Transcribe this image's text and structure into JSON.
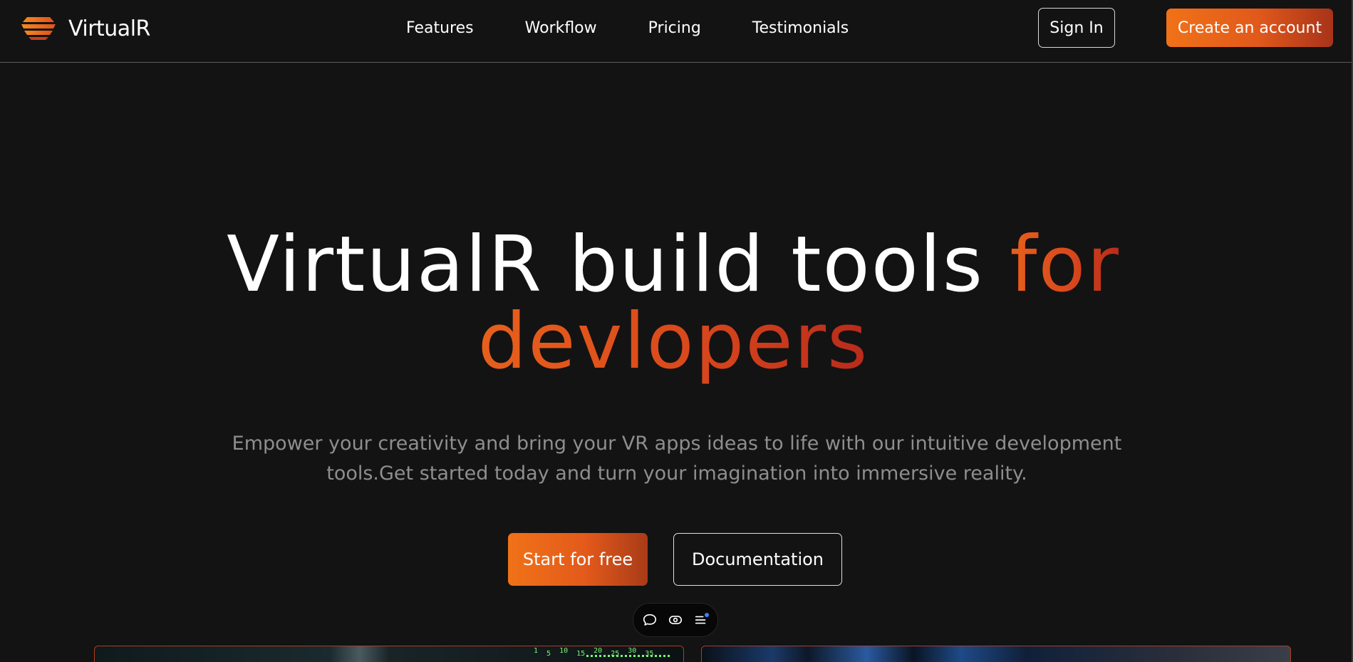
{
  "brand": {
    "name": "VirtualR",
    "logo_icon": "stacked-bars-logo",
    "accent_color": "#f07218",
    "accent_dark": "#a8331a"
  },
  "nav": {
    "links": [
      "Features",
      "Workflow",
      "Pricing",
      "Testimonials"
    ],
    "signin_label": "Sign In",
    "create_label": "Create an account"
  },
  "hero": {
    "title_part1": "VirtualR build tools ",
    "title_accent_word": "for",
    "title_accent_line2": "devlopers",
    "subtitle": "Empower your creativity and bring your VR apps ideas to life with our intuitive development tools.Get started today and turn your imagination into immersive reality.",
    "primary_cta": "Start for free",
    "secondary_cta": "Documentation"
  },
  "toolbar": {
    "icons": [
      "chat-bubble-icon",
      "eye-toggle-icon",
      "menu-list-icon"
    ]
  },
  "preview": {
    "code_numbers": [
      "1",
      "5",
      "10",
      "15",
      "20",
      "25",
      "30",
      "35"
    ]
  }
}
